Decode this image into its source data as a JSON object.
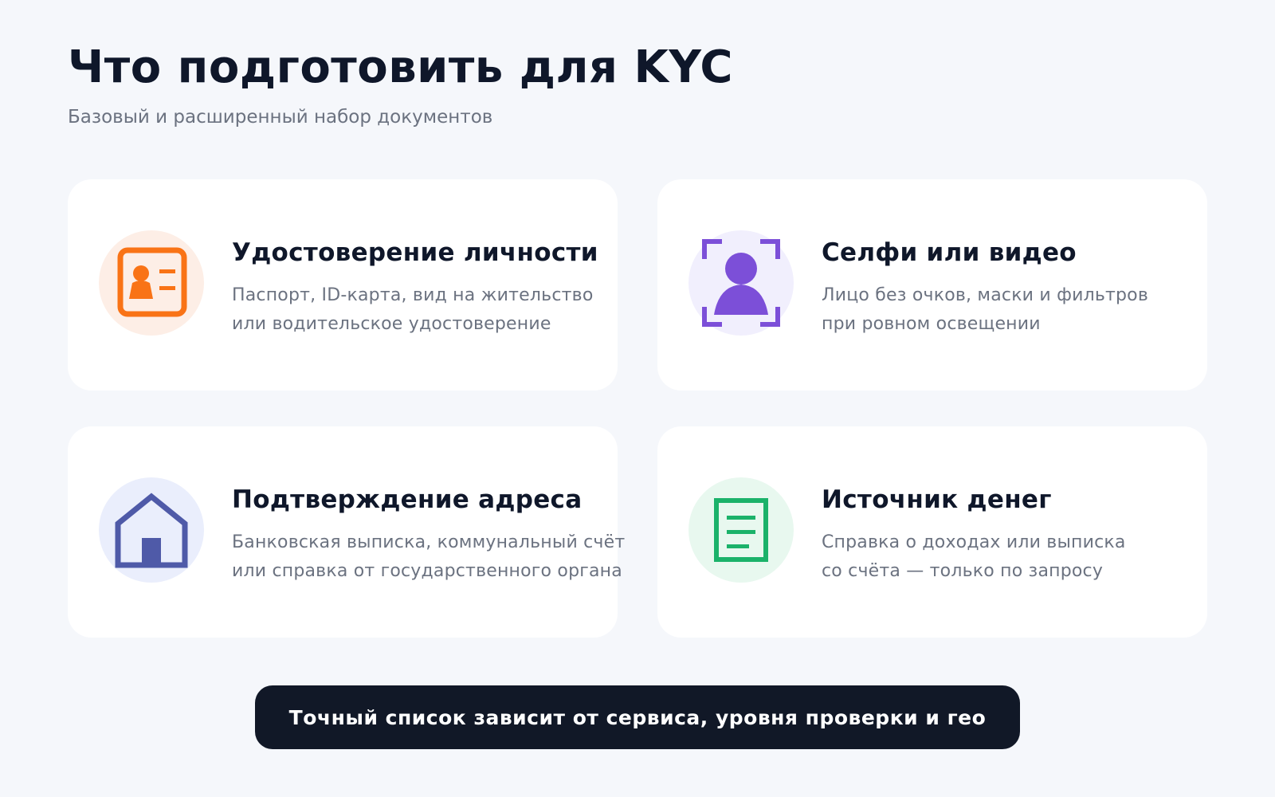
{
  "header": {
    "title": "Что подготовить для KYC",
    "subtitle": "Базовый и расширенный набор документов"
  },
  "cards": [
    {
      "title": "Удостоверение личности",
      "desc_line1": "Паспорт, ID-карта, вид на жительство",
      "desc_line2": "или водительское удостоверение",
      "icon": "id-card-icon",
      "accent": "#f97316",
      "bg": "#fdeee6"
    },
    {
      "title": "Селфи или видео",
      "desc_line1": "Лицо без очков, маски и фильтров",
      "desc_line2": "при ровном освещении",
      "icon": "selfie-icon",
      "accent": "#7c4fd8",
      "bg": "#f1effd"
    },
    {
      "title": "Подтверждение адреса",
      "desc_line1": "Банковская выписка, коммунальный счёт",
      "desc_line2": "или справка от государственного органа",
      "icon": "house-icon",
      "accent": "#4f5aa8",
      "bg": "#eaeefc"
    },
    {
      "title": "Источник денег",
      "desc_line1": "Справка о доходах или выписка",
      "desc_line2": "со счёта — только по запросу",
      "icon": "document-icon",
      "accent": "#1bb26a",
      "bg": "#e8f8ef"
    }
  ],
  "footer": {
    "note": "Точный список зависит от сервиса, уровня проверки и гео"
  }
}
